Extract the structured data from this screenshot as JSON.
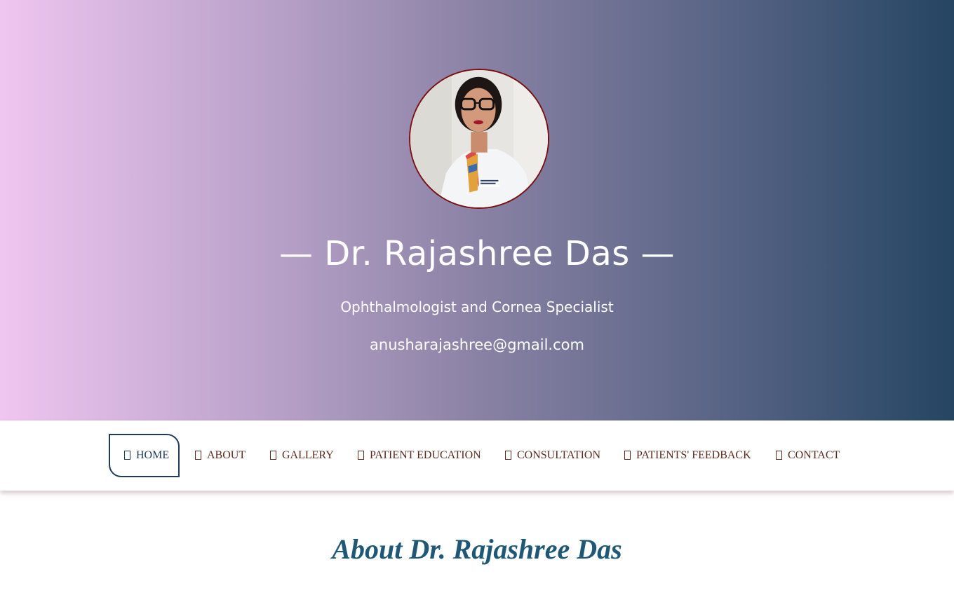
{
  "hero": {
    "name": "— Dr. Rajashree Das —",
    "role": "Ophthalmologist and Cornea Specialist",
    "email": "anusharajashree@gmail.com",
    "gradient_colors": [
      "#efc6f0",
      "#254563"
    ]
  },
  "nav": {
    "items": [
      {
        "label": "HOME",
        "active": true
      },
      {
        "label": "ABOUT"
      },
      {
        "label": "GALLERY"
      },
      {
        "label": "PATIENT EDUCATION"
      },
      {
        "label": "CONSULTATION"
      },
      {
        "label": "PATIENTS' FEEDBACK"
      },
      {
        "label": "CONTACT"
      }
    ]
  },
  "about": {
    "title": "About Dr. Rajashree Das"
  },
  "colors": {
    "nav_text": "#5a2a1e",
    "nav_active": "#1f3b5c",
    "about_title": "#1f5876"
  }
}
